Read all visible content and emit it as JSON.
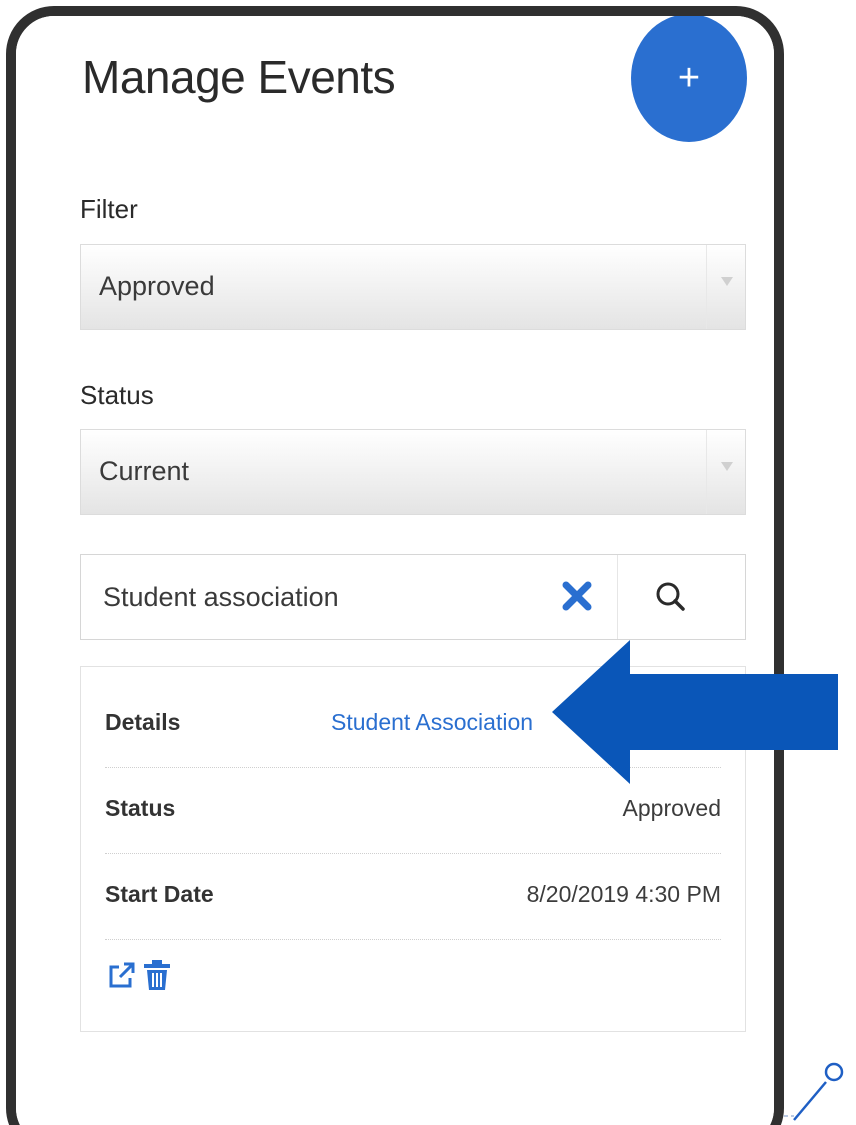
{
  "page": {
    "title": "Manage Events",
    "add_button_label": "+"
  },
  "filter": {
    "label": "Filter",
    "selected": "Approved"
  },
  "status_filter": {
    "label": "Status",
    "selected": "Current"
  },
  "search": {
    "value": "Student association"
  },
  "event_card": {
    "details_label": "Details",
    "details_value": "Student Association",
    "status_label": "Status",
    "status_value": "Approved",
    "start_date_label": "Start Date",
    "start_date_value": "8/20/2019 4:30 PM"
  },
  "colors": {
    "accent": "#2a6fd0",
    "arrow": "#0a56b8",
    "frame": "#303030"
  },
  "icons": {
    "add": "plus-icon",
    "clear": "x-icon",
    "search": "magnifier-icon",
    "edit": "external-link-icon",
    "delete": "trash-icon"
  }
}
